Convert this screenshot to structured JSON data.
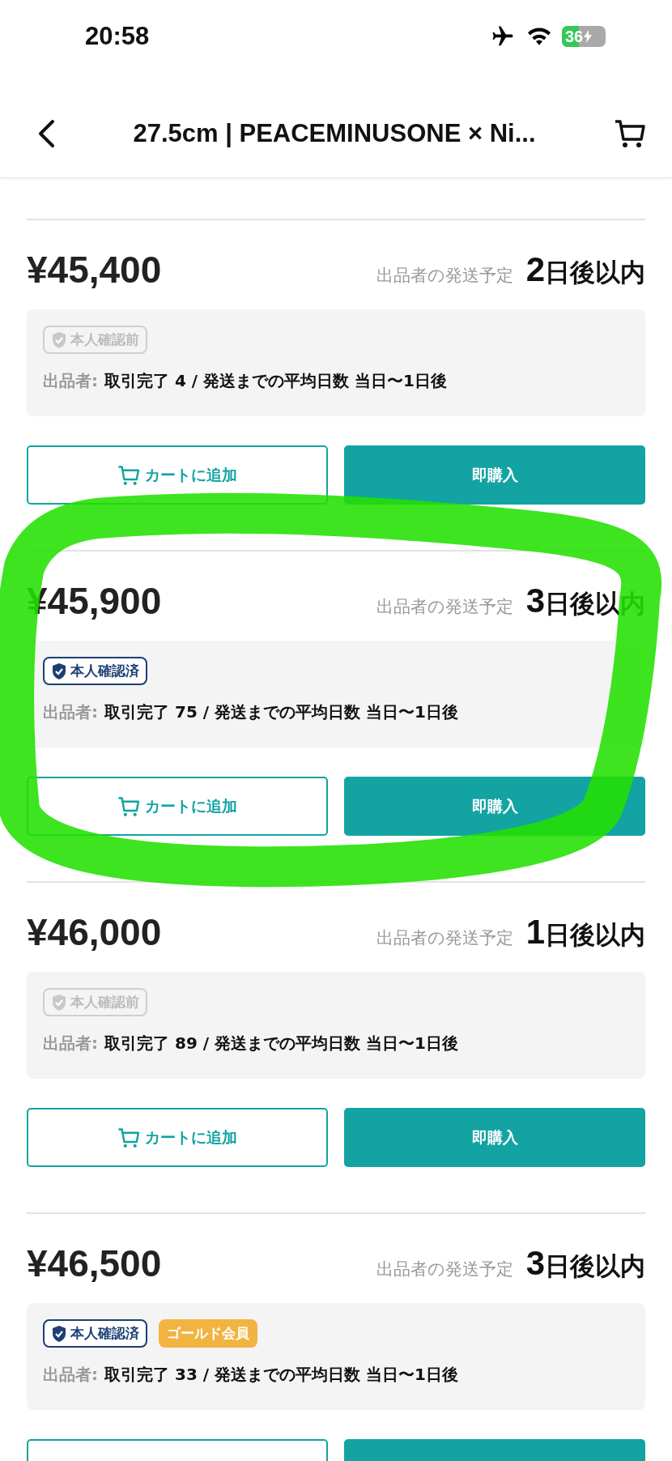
{
  "status_bar": {
    "time": "20:58",
    "battery": "36"
  },
  "header": {
    "title": "27.5cm | PEACEMINUSONE × Ni..."
  },
  "listings": [
    {
      "price": "¥45,400",
      "ship_label": "出品者の発送予定",
      "ship_days": "2",
      "ship_suffix": "日後以内",
      "badges": [
        {
          "kind": "unverified",
          "label": "本人確認前"
        }
      ],
      "seller_label": "出品者:",
      "seller_info": "取引完了 4 / 発送までの平均日数 当日〜1日後",
      "cart_label": "カートに追加",
      "buy_label": "即購入"
    },
    {
      "price": "¥45,900",
      "ship_label": "出品者の発送予定",
      "ship_days": "3",
      "ship_suffix": "日後以内",
      "badges": [
        {
          "kind": "verified",
          "label": "本人確認済"
        }
      ],
      "seller_label": "出品者:",
      "seller_info": "取引完了 75 / 発送までの平均日数 当日〜1日後",
      "cart_label": "カートに追加",
      "buy_label": "即購入"
    },
    {
      "price": "¥46,000",
      "ship_label": "出品者の発送予定",
      "ship_days": "1",
      "ship_suffix": "日後以内",
      "badges": [
        {
          "kind": "unverified",
          "label": "本人確認前"
        }
      ],
      "seller_label": "出品者:",
      "seller_info": "取引完了 89 / 発送までの平均日数 当日〜1日後",
      "cart_label": "カートに追加",
      "buy_label": "即購入"
    },
    {
      "price": "¥46,500",
      "ship_label": "出品者の発送予定",
      "ship_days": "3",
      "ship_suffix": "日後以内",
      "badges": [
        {
          "kind": "verified",
          "label": "本人確認済"
        },
        {
          "kind": "gold",
          "label": "ゴールド会員"
        }
      ],
      "seller_label": "出品者:",
      "seller_info": "取引完了 33 / 発送までの平均日数 当日〜1日後"
    }
  ],
  "annotation": {
    "kind": "circle"
  }
}
